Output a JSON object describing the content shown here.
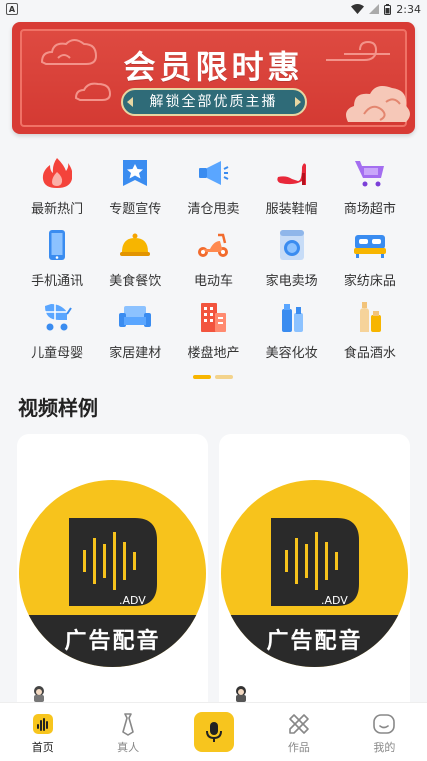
{
  "status_bar": {
    "app_badge": "A",
    "time": "2:34"
  },
  "banner": {
    "title": "会员限时惠",
    "subtitle": "解锁全部优质主播",
    "colors": {
      "bg": "#d83b35",
      "pill": "#2f6b78",
      "gold": "#e8d6a2"
    }
  },
  "categories": [
    {
      "label": "最新热门",
      "icon": "flame-icon"
    },
    {
      "label": "专题宣传",
      "icon": "star-badge-icon"
    },
    {
      "label": "清仓甩卖",
      "icon": "megaphone-icon"
    },
    {
      "label": "服装鞋帽",
      "icon": "high-heel-icon"
    },
    {
      "label": "商场超市",
      "icon": "shopping-cart-icon"
    },
    {
      "label": "手机通讯",
      "icon": "mobile-phone-icon"
    },
    {
      "label": "美食餐饮",
      "icon": "food-cloche-icon"
    },
    {
      "label": "电动车",
      "icon": "scooter-icon"
    },
    {
      "label": "家电卖场",
      "icon": "washing-machine-icon"
    },
    {
      "label": "家纺床品",
      "icon": "bed-icon"
    },
    {
      "label": "儿童母婴",
      "icon": "stroller-icon"
    },
    {
      "label": "家居建材",
      "icon": "sofa-icon"
    },
    {
      "label": "楼盘地产",
      "icon": "building-icon"
    },
    {
      "label": "美容化妆",
      "icon": "cosmetics-icon"
    },
    {
      "label": "食品酒水",
      "icon": "bottle-icon"
    }
  ],
  "section": {
    "title": "视频样例"
  },
  "cards": [
    {
      "thumb_text": "广告配音",
      "logo_text": ".ADV"
    },
    {
      "thumb_text": "广告配音",
      "logo_text": ".ADV"
    }
  ],
  "nav": {
    "items": [
      {
        "label": "首页",
        "icon": "home-soundwave-icon",
        "active": true
      },
      {
        "label": "真人",
        "icon": "tie-icon",
        "active": false
      },
      {
        "label": "",
        "icon": "microphone-icon",
        "active": false
      },
      {
        "label": "作品",
        "icon": "pencil-ruler-icon",
        "active": false
      },
      {
        "label": "我的",
        "icon": "smile-face-icon",
        "active": false
      }
    ]
  },
  "accent": "#f7c51e"
}
